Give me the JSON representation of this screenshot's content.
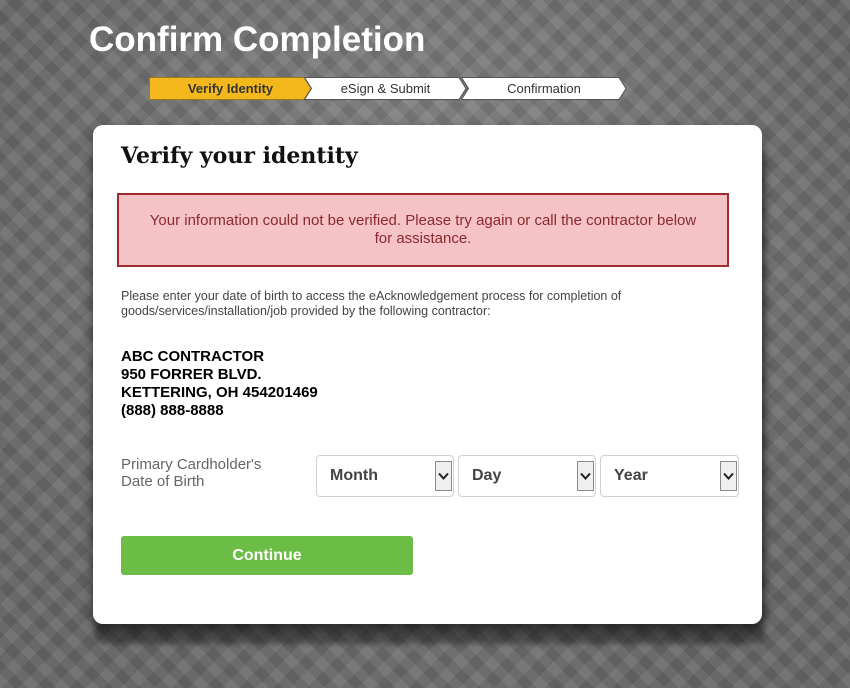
{
  "header": {
    "title": "Confirm Completion"
  },
  "steps": [
    {
      "label": "Verify Identity",
      "state": "active"
    },
    {
      "label": "eSign & Submit",
      "state": "inactive"
    },
    {
      "label": "Confirmation",
      "state": "inactive"
    }
  ],
  "card": {
    "heading": "Verify your identity",
    "error_message": "Your information could not be verified. Please try again or call the contractor below for assistance.",
    "intro": "Please enter your date of birth to access the eAcknowledgement process for completion of goods/services/installation/job provided by the following contractor:",
    "contractor": {
      "name": "ABC CONTRACTOR",
      "address1": "950 FORRER BLVD.",
      "address2": "KETTERING, OH 454201469",
      "phone": "(888) 888-8888"
    },
    "dob_label": "Primary Cardholder's Date of Birth",
    "month_select": {
      "value": "Month"
    },
    "day_select": {
      "value": "Day"
    },
    "year_select": {
      "value": "Year"
    },
    "continue_label": "Continue"
  },
  "colors": {
    "active_step": "#f5b81c",
    "error_background": "#f5c2c5",
    "error_border": "#9e2b30",
    "continue_button": "#6cbd45"
  },
  "icons": {
    "select_arrow": "chevron-down-icon"
  }
}
